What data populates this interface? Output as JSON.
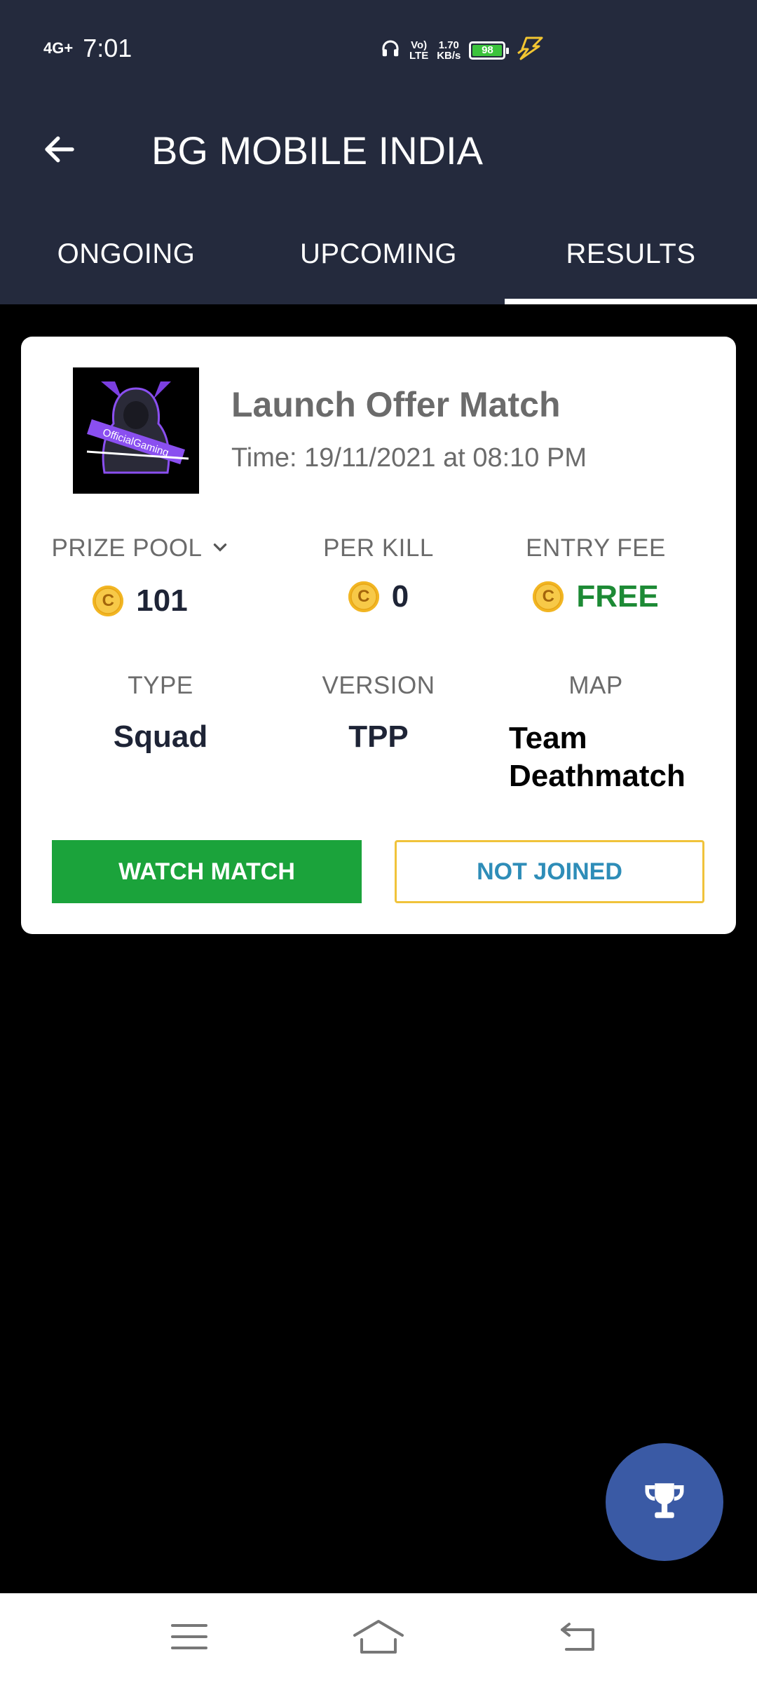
{
  "status_bar": {
    "network": "4G+",
    "time": "7:01",
    "volte_top": "Vo)",
    "volte_bottom": "LTE",
    "speed_value": "1.70",
    "speed_unit": "KB/s",
    "battery": "98"
  },
  "header": {
    "title": "BG MOBILE INDIA"
  },
  "tabs": [
    {
      "label": "ONGOING"
    },
    {
      "label": "UPCOMING"
    },
    {
      "label": "RESULTS"
    }
  ],
  "match": {
    "avatar_text": "OfficialGaming",
    "title": "Launch Offer Match",
    "time": "Time: 19/11/2021 at 08:10 PM",
    "prize_pool_label": "PRIZE POOL",
    "prize_pool_value": "101",
    "per_kill_label": "PER KILL",
    "per_kill_value": "0",
    "entry_fee_label": "ENTRY FEE",
    "entry_fee_value": "FREE",
    "type_label": "TYPE",
    "type_value": "Squad",
    "version_label": "VERSION",
    "version_value": "TPP",
    "map_label": "MAP",
    "map_value_line1": "Team",
    "map_value_line2": "Deathmatch",
    "coin_symbol": "C",
    "watch_button": "WATCH MATCH",
    "joined_button": "NOT JOINED"
  },
  "colors": {
    "appbar_bg": "#242a3d",
    "watch_green": "#1ba33b",
    "free_green": "#1d8a35",
    "not_joined_border": "#f0c33b",
    "not_joined_text": "#2e8db8",
    "fab_blue": "#3a5aa5"
  },
  "icons": {
    "back": "arrow-left-icon",
    "fab": "trophy-icon",
    "nav_menu": "menu-icon",
    "nav_home": "home-icon",
    "nav_back": "back-icon",
    "prize_toggle": "chevron-down-icon"
  }
}
